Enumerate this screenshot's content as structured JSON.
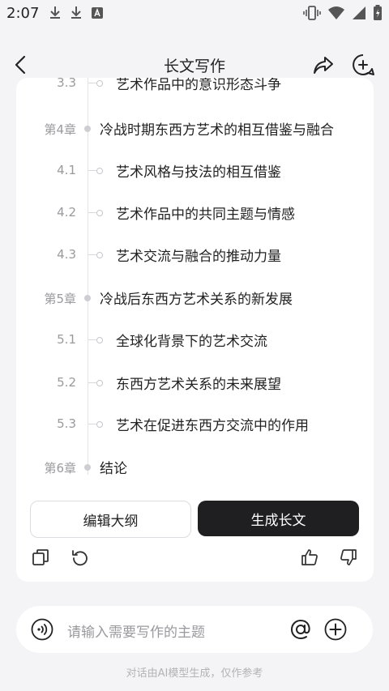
{
  "status_bar": {
    "time": "2:07",
    "left_icons": [
      "download-icon",
      "download-icon",
      "a-notification-icon"
    ],
    "right_icons": [
      "vibrate-icon",
      "wifi-icon",
      "signal-icon",
      "battery-icon"
    ]
  },
  "header": {
    "title": "长文写作",
    "icons": [
      "back-icon",
      "share-icon",
      "new-chat-icon"
    ]
  },
  "outline": {
    "partial_top_text": "艺术作品中的意识形态斗争",
    "partial_top_num": "3.3",
    "items": [
      {
        "type": "chapter",
        "num": "第4章",
        "text": "冷战时期东西方艺术的相互借鉴与融合"
      },
      {
        "type": "section",
        "num": "4.1",
        "text": "艺术风格与技法的相互借鉴"
      },
      {
        "type": "section",
        "num": "4.2",
        "text": "艺术作品中的共同主题与情感"
      },
      {
        "type": "section",
        "num": "4.3",
        "text": "艺术交流与融合的推动力量"
      },
      {
        "type": "chapter",
        "num": "第5章",
        "text": "冷战后东西方艺术关系的新发展"
      },
      {
        "type": "section",
        "num": "5.1",
        "text": "全球化背景下的艺术交流"
      },
      {
        "type": "section",
        "num": "5.2",
        "text": "东西方艺术关系的未来展望"
      },
      {
        "type": "section",
        "num": "5.3",
        "text": "艺术在促进东西方交流中的作用"
      },
      {
        "type": "chapter",
        "num": "第6章",
        "text": "结论"
      }
    ]
  },
  "buttons": {
    "edit_outline": "编辑大纲",
    "generate_long_text": "生成长文"
  },
  "action_icons": [
    "copy-icon",
    "regenerate-icon",
    "thumbs-up-icon",
    "thumbs-down-icon"
  ],
  "input": {
    "placeholder": "请输入需要写作的主题",
    "icons": [
      "voice-icon",
      "at-icon",
      "add-icon"
    ]
  },
  "disclaimer": "对话由AI模型生成，仅作参考",
  "colors": {
    "background": "#f4f4f6",
    "card": "#ffffff",
    "primary_button": "#1f1f21",
    "muted_text": "#9a9a9e"
  }
}
